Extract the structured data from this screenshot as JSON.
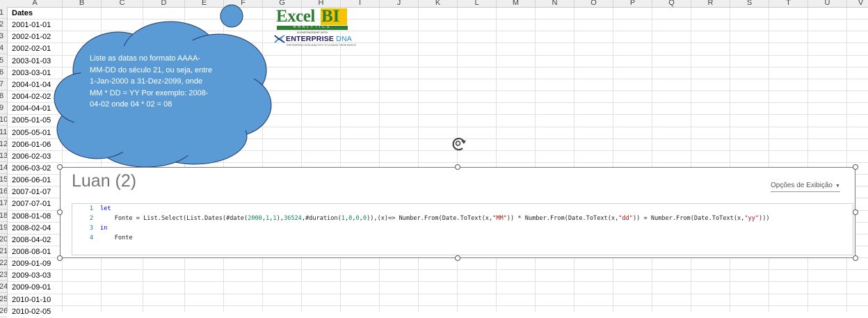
{
  "spreadsheet": {
    "columns": [
      "A",
      "B",
      "C",
      "D",
      "E",
      "F",
      "G",
      "H",
      "I",
      "J",
      "K",
      "L",
      "M",
      "N",
      "O",
      "P",
      "Q",
      "R",
      "S",
      "T",
      "U",
      "V"
    ],
    "rows": [
      "1",
      "2",
      "3",
      "4",
      "5",
      "6",
      "7",
      "8",
      "9",
      "10",
      "11",
      "12",
      "13",
      "14",
      "15",
      "16",
      "17",
      "18",
      "19",
      "20",
      "21",
      "22",
      "23",
      "24",
      "25",
      "26"
    ],
    "column_a_header": "Dates",
    "column_a_values": [
      "2001-01-01",
      "2002-01-02",
      "2002-02-01",
      "2003-01-03",
      "2003-03-01",
      "2004-01-04",
      "2004-02-02",
      "2004-04-01",
      "2005-01-05",
      "2005-05-01",
      "2006-01-06",
      "2006-02-03",
      "2006-03-02",
      "2006-06-01",
      "2007-01-07",
      "2007-07-01",
      "2008-01-08",
      "2008-02-04",
      "2008-04-02",
      "2008-08-01",
      "2009-01-09",
      "2009-03-03",
      "2009-09-01",
      "2010-01-10",
      "2010-02-05"
    ]
  },
  "callout": {
    "lines": [
      "Liste as datas no formato AAAA-",
      "MM-DD do século 21, ou seja, entre",
      "1-Jan-2000 a 31-Dez-2099, onde",
      "MM * DD = YY Por exemplo: 2008-",
      "04-02 onde 04 * 02 = 08"
    ],
    "fill_color": "#5b9bd5",
    "stroke_color": "#1f3864"
  },
  "logo": {
    "excel": "Excel",
    "bi": "BI",
    "analytics": "ANALYTICS",
    "partnership": "IN PARTNERSHIP WITH",
    "enterprise": "ENTERPRISE",
    "dna": "DNA",
    "tagline": "EMPOWERING DATA ANALYSTS TO CHANGE THEIR WORLD"
  },
  "query_card": {
    "title": "Luan (2)",
    "view_options": "Opções de Exibição",
    "view_options_icon": "caret-down-icon",
    "code": {
      "line_numbers": [
        "1",
        "2",
        "3",
        "4"
      ],
      "l1_kw": "let",
      "l2_a": "    Fonte = List.Select(List.Dates(#date(",
      "l2_n1": "2000",
      "l2_c1": ",",
      "l2_n2": "1",
      "l2_c2": ",",
      "l2_n3": "1",
      "l2_c3": "),",
      "l2_n4": "36524",
      "l2_c4": ",#duration(",
      "l2_n5": "1",
      "l2_c5": ",",
      "l2_n6": "0",
      "l2_c6": ",",
      "l2_n7": "0",
      "l2_c7": ",",
      "l2_n8": "0",
      "l2_c8": ")),(x)=> Number.From(Date.ToText(x,",
      "l2_s1": "\"MM\"",
      "l2_c9": ")) * Number.From(Date.ToText(x,",
      "l2_s2": "\"dd\"",
      "l2_c10": ")) = Number.From(Date.ToText(x,",
      "l2_s3": "\"yy\"",
      "l2_c11": ")))",
      "l3_kw": "in",
      "l4": "    Fonte"
    }
  },
  "colors": {
    "code_keyword": "#0000ff",
    "code_string": "#a31515",
    "code_number": "#098658",
    "logo_green": "#2e7d32",
    "logo_yellow": "#f5c400"
  }
}
